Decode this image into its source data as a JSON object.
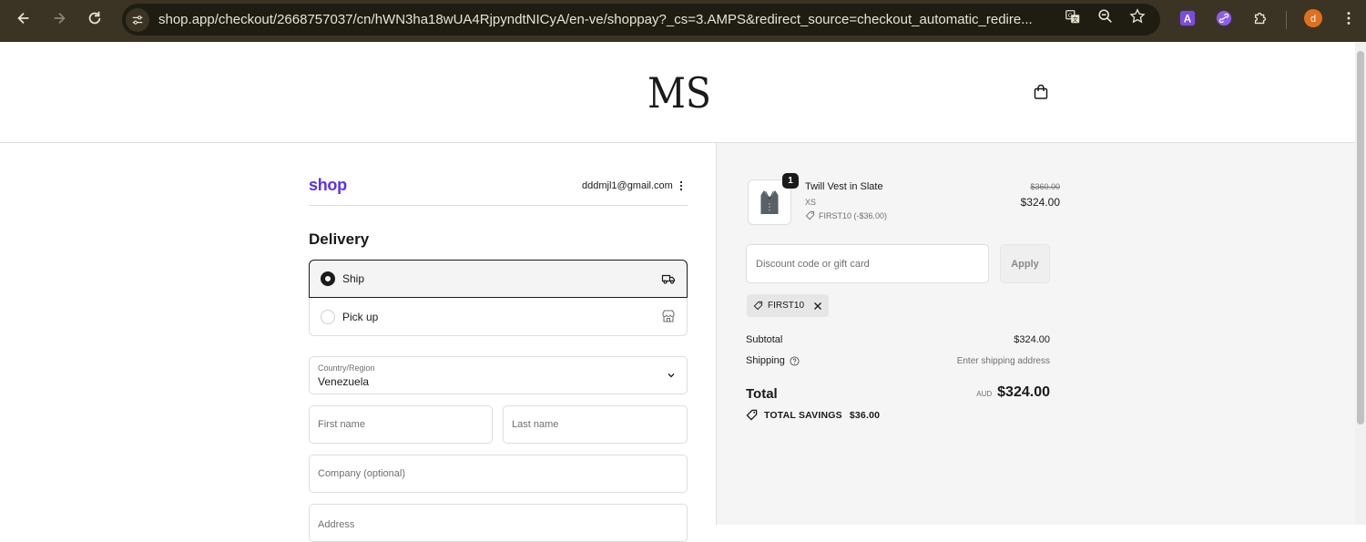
{
  "browser": {
    "url": "shop.app/checkout/2668757037/cn/hWN3ha18wUA4RjpyndtNICyA/en-ve/shoppay?_cs=3.AMPS&redirect_source=checkout_automatic_redire...",
    "profile_initial": "d",
    "ext_letter": "A"
  },
  "store": {
    "logo_text": "MS"
  },
  "account": {
    "brand": "shop",
    "email": "dddmjl1@gmail.com"
  },
  "delivery": {
    "heading": "Delivery",
    "options": [
      {
        "label": "Ship",
        "selected": true
      },
      {
        "label": "Pick up",
        "selected": false
      }
    ]
  },
  "form": {
    "country_label": "Country/Region",
    "country_value": "Venezuela",
    "first_name_placeholder": "First name",
    "last_name_placeholder": "Last name",
    "company_placeholder": "Company (optional)",
    "address_placeholder": "Address"
  },
  "summary": {
    "item": {
      "quantity": "1",
      "name": "Twill Vest in Slate",
      "variant": "XS",
      "discount": "FIRST10 (-$36.00)",
      "original_price": "$360.00",
      "price": "$324.00"
    },
    "discount_placeholder": "Discount code or gift card",
    "apply_label": "Apply",
    "applied_code": "FIRST10",
    "subtotal_label": "Subtotal",
    "subtotal_value": "$324.00",
    "shipping_label": "Shipping",
    "shipping_value": "Enter shipping address",
    "total_label": "Total",
    "currency": "AUD",
    "total_value": "$324.00",
    "savings_label": "TOTAL SAVINGS",
    "savings_value": "$36.00"
  },
  "colors": {
    "shop_brand": "#5a31f4",
    "chrome_bg": "#3b3424",
    "summary_bg": "#f5f5f5"
  }
}
